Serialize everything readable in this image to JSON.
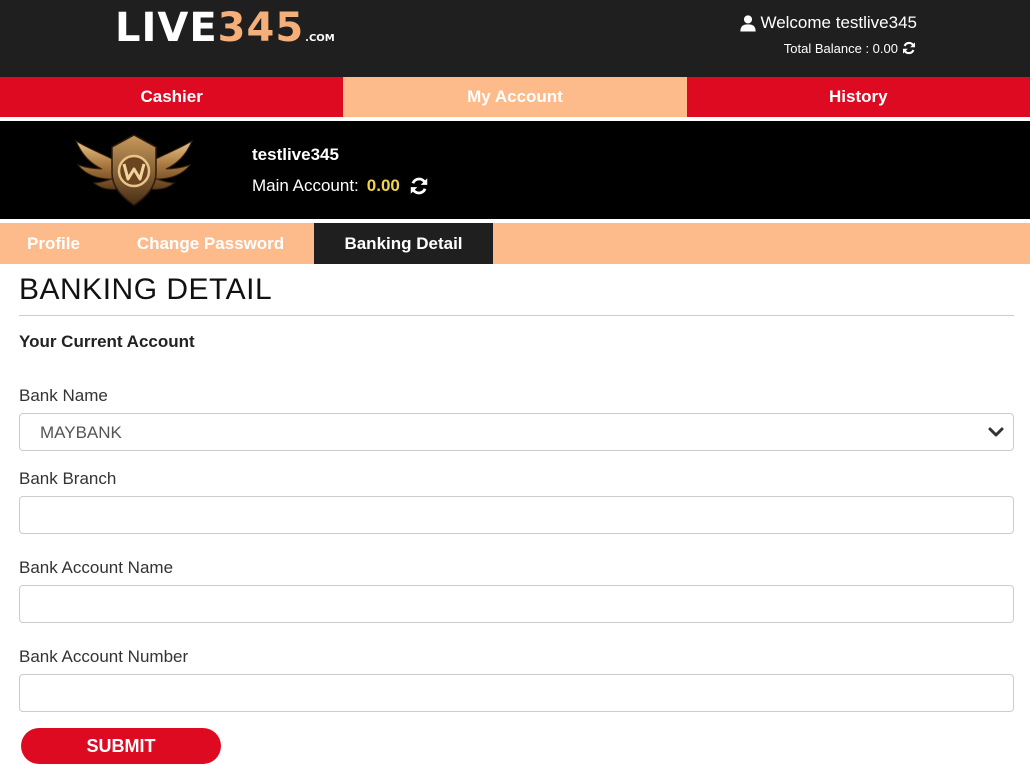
{
  "header": {
    "logo_main": "LIVE",
    "logo_number": "345",
    "logo_suffix": ".COM",
    "welcome_text": "Welcome testlive345",
    "balance_text": "Total Balance : 0.00"
  },
  "nav": {
    "items": [
      {
        "label": "Cashier"
      },
      {
        "label": "My Account"
      },
      {
        "label": "History"
      }
    ]
  },
  "profile": {
    "username": "testlive345",
    "main_account_label": "Main Account:",
    "main_account_value": "0.00"
  },
  "subtabs": {
    "items": [
      {
        "label": "Profile"
      },
      {
        "label": "Change Password"
      },
      {
        "label": "Banking Detail"
      }
    ]
  },
  "form": {
    "title": "BANKING DETAIL",
    "subtitle": "Your Current Account",
    "bank_name_label": "Bank Name",
    "bank_name_value": "MAYBANK",
    "bank_branch_label": "Bank Branch",
    "bank_account_name_label": "Bank Account Name",
    "bank_account_number_label": "Bank Account Number",
    "submit_label": "SUBMIT"
  },
  "colors": {
    "header_bg": "#1f1f1f",
    "brand_red": "#dd0a22",
    "accent_peach": "#fdbb8b",
    "logo_orange": "#f5b07a",
    "balance_yellow": "#f0d34a"
  },
  "icons": {
    "user": "user-icon",
    "refresh": "refresh-icon",
    "badge": "wing-badge-icon",
    "chevron": "chevron-down-icon"
  }
}
